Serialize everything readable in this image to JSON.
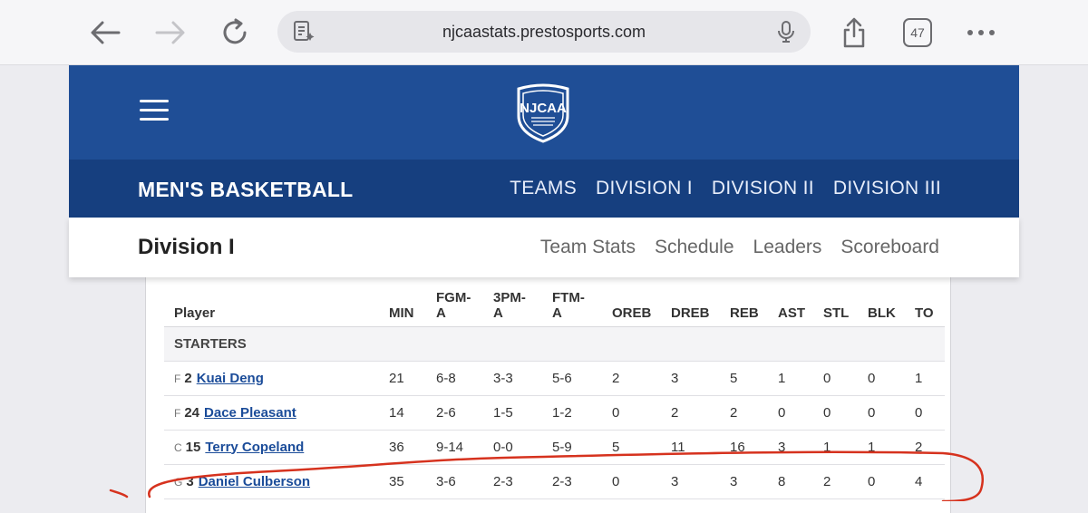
{
  "browser": {
    "url": "njcaastats.prestosports.com",
    "tab_count": "47"
  },
  "header": {
    "logo_text": "NJCAA"
  },
  "sportbar": {
    "title": "MEN'S BASKETBALL",
    "nav": [
      "TEAMS",
      "DIVISION I",
      "DIVISION II",
      "DIVISION III"
    ]
  },
  "subbar": {
    "title": "Division I",
    "nav": [
      "Team Stats",
      "Schedule",
      "Leaders",
      "Scoreboard"
    ]
  },
  "boxscore": {
    "columns": [
      "Player",
      "MIN",
      "FGM-\nA",
      "3PM-\nA",
      "FTM-\nA",
      "OREB",
      "DREB",
      "REB",
      "AST",
      "STL",
      "BLK",
      "TO"
    ],
    "section_label": "STARTERS",
    "rows": [
      {
        "pos": "F",
        "num": "2",
        "name": "Kuai Deng",
        "stats": [
          "21",
          "6-8",
          "3-3",
          "5-6",
          "2",
          "3",
          "5",
          "1",
          "0",
          "0",
          "1"
        ]
      },
      {
        "pos": "F",
        "num": "24",
        "name": "Dace Pleasant",
        "stats": [
          "14",
          "2-6",
          "1-5",
          "1-2",
          "0",
          "2",
          "2",
          "0",
          "0",
          "0",
          "0"
        ]
      },
      {
        "pos": "C",
        "num": "15",
        "name": "Terry Copeland",
        "stats": [
          "36",
          "9-14",
          "0-0",
          "5-9",
          "5",
          "11",
          "16",
          "3",
          "1",
          "1",
          "2"
        ]
      },
      {
        "pos": "G",
        "num": "3",
        "name": "Daniel Culberson",
        "stats": [
          "35",
          "3-6",
          "2-3",
          "2-3",
          "0",
          "3",
          "3",
          "8",
          "2",
          "0",
          "4"
        ]
      }
    ]
  },
  "colors": {
    "topbar": "#1f4e96",
    "sportbar": "#163f7f",
    "link": "#1b4c99",
    "annotation": "#d6321e"
  }
}
